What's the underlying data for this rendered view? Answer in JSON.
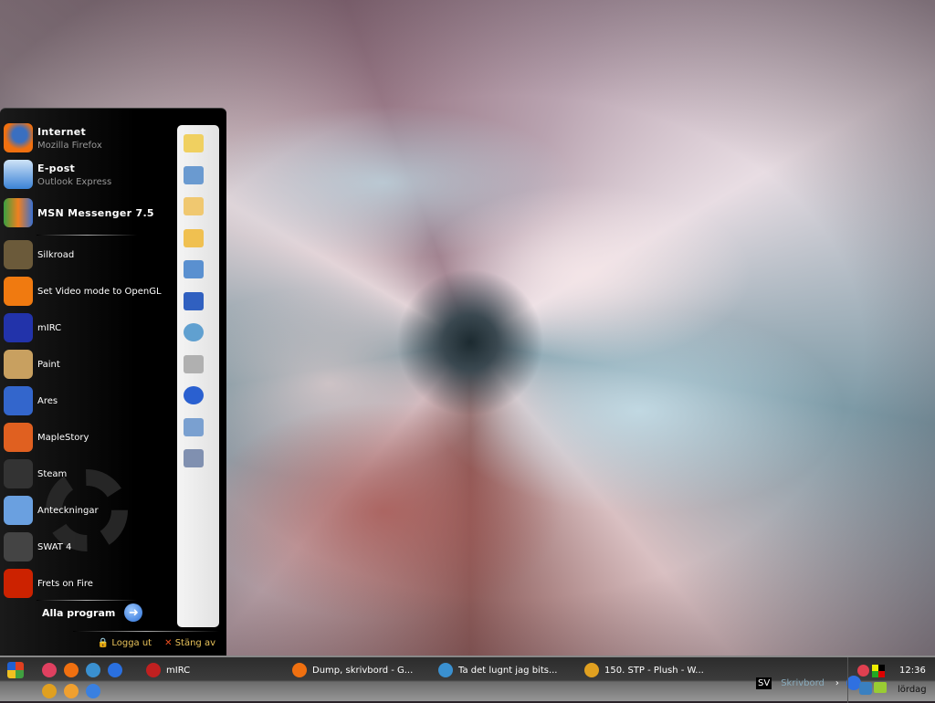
{
  "start_menu": {
    "pinned": [
      {
        "title": "Internet",
        "subtitle": "Mozilla Firefox",
        "icon": "firefox-icon"
      },
      {
        "title": "E-post",
        "subtitle": "Outlook Express",
        "icon": "outlook-icon"
      },
      {
        "title": "MSN Messenger 7.5",
        "icon": "msn-icon"
      }
    ],
    "recent": [
      {
        "label": "Silkroad",
        "icon": "silkroad-icon",
        "color": "#6b5a3a"
      },
      {
        "label": "Set Video mode to OpenGL",
        "icon": "vlc-cone-icon",
        "color": "#f07a10"
      },
      {
        "label": "mIRC",
        "icon": "mirc-icon",
        "color": "#2233aa"
      },
      {
        "label": "Paint",
        "icon": "paint-icon",
        "color": "#c8a060"
      },
      {
        "label": "Ares",
        "icon": "ares-icon",
        "color": "#3366cc"
      },
      {
        "label": "MapleStory",
        "icon": "maplestory-icon",
        "color": "#e06020"
      },
      {
        "label": "Steam",
        "icon": "steam-icon",
        "color": "#333333"
      },
      {
        "label": "Anteckningar",
        "icon": "notepad-icon",
        "color": "#6aa0e0"
      },
      {
        "label": "SWAT 4",
        "icon": "swat-icon",
        "color": "#444444"
      },
      {
        "label": "Frets on Fire",
        "icon": "frets-icon",
        "color": "#cc2200"
      }
    ],
    "all_programs": "Alla program",
    "log_off": "Logga ut",
    "shut_down": "Stäng av",
    "side_icons": [
      "my-documents-icon",
      "recent-documents-icon",
      "my-pictures-icon",
      "my-music-icon",
      "my-computer-icon",
      "control-panel-icon",
      "network-icon",
      "printers-icon",
      "help-icon",
      "search-icon",
      "run-icon"
    ]
  },
  "taskbar": {
    "quicklaunch": [
      "cs-icon",
      "firefox-icon",
      "msn-icon",
      "ie-icon",
      "winamp-icon",
      "media-player-icon",
      "outlook-icon"
    ],
    "tasks": [
      {
        "label": "mIRC",
        "icon": "mirc-icon"
      },
      {
        "label": "Dump, skrivbord - G...",
        "icon": "firefox-icon"
      },
      {
        "label": "Ta det lugnt jag bits...",
        "icon": "msn-icon"
      },
      {
        "label": "150. STP - Plush - W...",
        "icon": "winamp-icon"
      }
    ],
    "language": "SV",
    "desktop_toolbar": "Skrivbord",
    "clock": "12:36",
    "day": "lördag"
  }
}
